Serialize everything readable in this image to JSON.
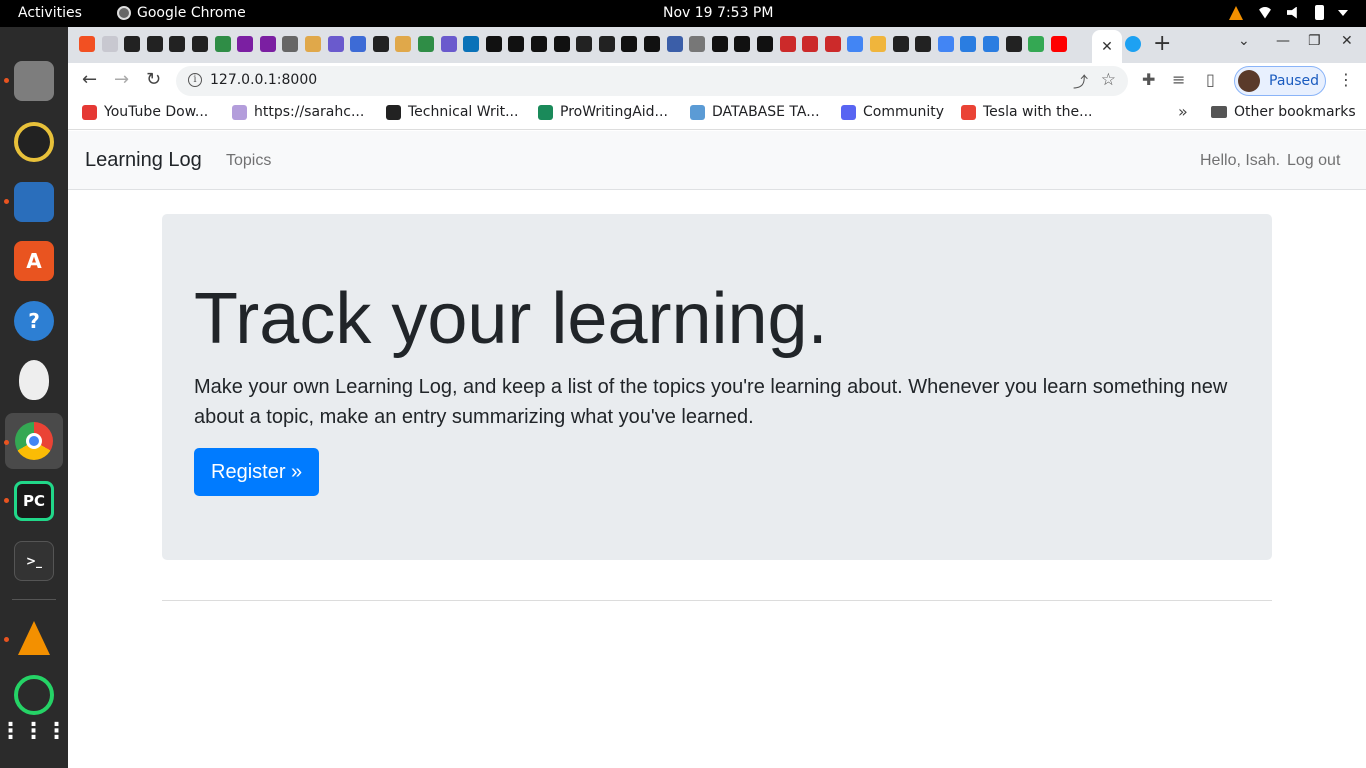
{
  "system": {
    "activities": "Activities",
    "app_name": "Google Chrome",
    "clock": "Nov 19   7:53 PM"
  },
  "dock": {
    "items": [
      "files-icon",
      "rhythmbox-icon",
      "writer-icon",
      "software-center-icon",
      "help-icon",
      "easy-eggs-icon",
      "chrome-icon",
      "pycharm-icon",
      "terminal-icon",
      "vlc-icon",
      "whatsapp-icon",
      "app-grid-icon"
    ],
    "pycharm_label": "PC"
  },
  "browser": {
    "tab_favicon_colors": [
      "#f25022",
      "#c8c8d0",
      "#222",
      "#222",
      "#222",
      "#222",
      "#2f8d46",
      "#7b1fa2",
      "#7b1fa2",
      "#666",
      "#e0a84a",
      "#6a5acd",
      "#3d6bd6",
      "#222",
      "#e0a84a",
      "#2f8d46",
      "#6a5acd",
      "#0a72b8",
      "#111",
      "#111",
      "#111",
      "#111",
      "#222",
      "#222",
      "#111",
      "#111",
      "#3b5ea8",
      "#777",
      "#111",
      "#111",
      "#111",
      "#cc2a2a",
      "#cc2a2a",
      "#cc2a2a",
      "#4285f4",
      "#f0b53c",
      "#222",
      "#222",
      "#4285f4",
      "#2a7de1",
      "#2a7de1",
      "#222",
      "#34a853",
      "#ff0000"
    ],
    "active_tab_close": "✕",
    "new_tab": "+",
    "url": "127.0.0.1:8000",
    "profile_status": "Paused"
  },
  "bookmarks": [
    {
      "label": "YouTube Dow...",
      "color": "#e53935"
    },
    {
      "label": "https://sarahc...",
      "color": "#b39ddb"
    },
    {
      "label": "Technical Writ...",
      "color": "#222222"
    },
    {
      "label": "ProWritingAid...",
      "color": "#1a8a5a"
    },
    {
      "label": "DATABASE TA...",
      "color": "#5b9bd5"
    },
    {
      "label": "Community",
      "color": "#5865f2"
    },
    {
      "label": "Tesla with the...",
      "color": "#ea4335"
    }
  ],
  "bookmarks_more": "»",
  "other_bookmarks": "Other bookmarks",
  "site": {
    "brand": "Learning Log",
    "nav_topics": "Topics",
    "greeting": "Hello, Isah.",
    "logout": "Log out",
    "heading": "Track your learning.",
    "lead": "Make your own Learning Log, and keep a list of the topics you're learning about. Whenever you learn something new about a topic, make an entry summarizing what you've learned.",
    "register_button": "Register »"
  }
}
